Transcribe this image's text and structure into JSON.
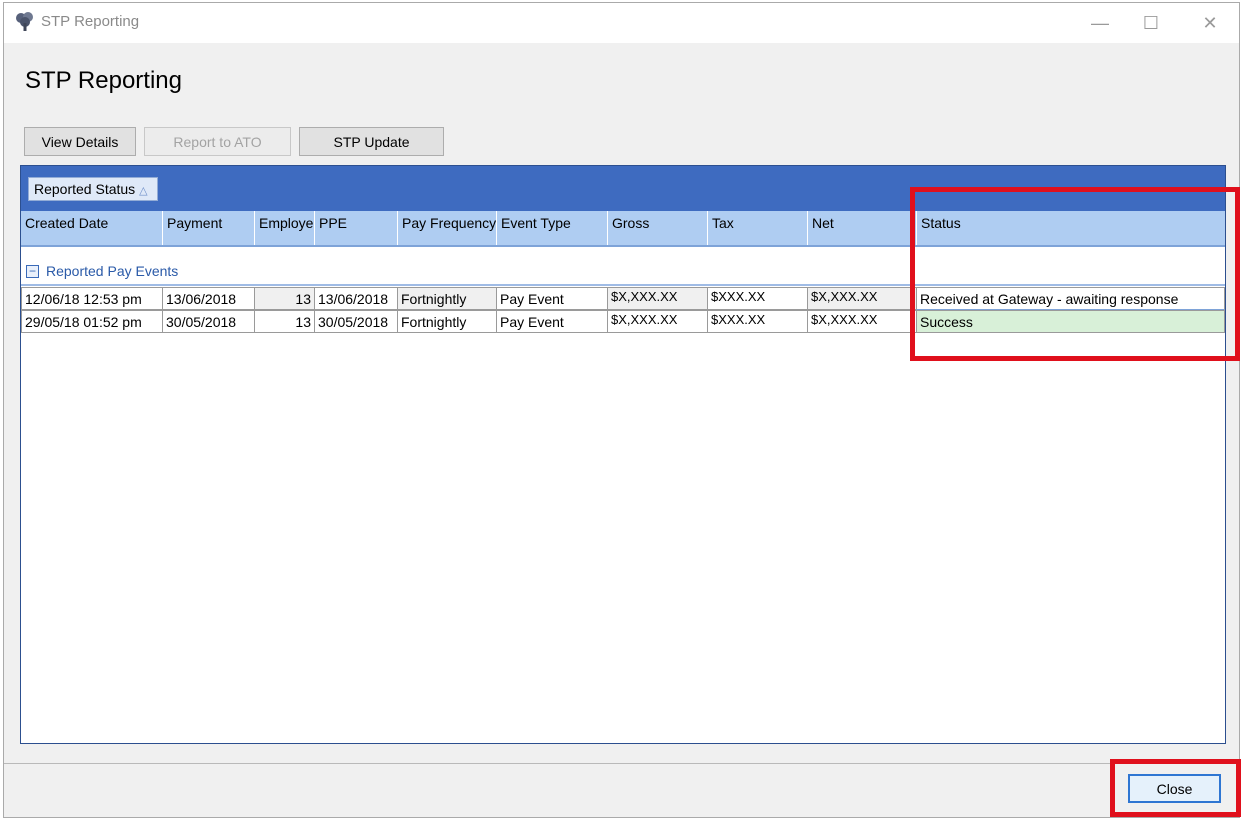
{
  "window": {
    "title": "STP Reporting",
    "controls": {
      "minimize": "—",
      "maximize": "☐",
      "close": "✕"
    }
  },
  "page_title": "STP Reporting",
  "toolbar": {
    "view_details": "View Details",
    "report_to_ato": "Report to ATO",
    "stp_update": "STP Update"
  },
  "grid": {
    "group_by_chip": "Reported Status",
    "group_by_sort_icon": "△",
    "columns": [
      "Created Date",
      "Payment",
      "Employe",
      "PPE",
      "Pay Frequency",
      "Event Type",
      "Gross",
      "Tax",
      "Net",
      "Status"
    ],
    "group": {
      "toggle": "−",
      "label": "Reported Pay Events"
    },
    "rows": [
      {
        "created_date": "12/06/18 12:53 pm",
        "payment": "13/06/2018",
        "employees": "13",
        "ppe": "13/06/2018",
        "pay_frequency": "Fortnightly",
        "event_type": "Pay Event",
        "gross": "$X,XXX.XX",
        "tax": "$XXX.XX",
        "net": "$X,XXX.XX",
        "status": "Received at Gateway - awaiting response"
      },
      {
        "created_date": "29/05/18 01:52 pm",
        "payment": "30/05/2018",
        "employees": "13",
        "ppe": "30/05/2018",
        "pay_frequency": "Fortnightly",
        "event_type": "Pay Event",
        "gross": "$X,XXX.XX",
        "tax": "$XXX.XX",
        "net": "$X,XXX.XX",
        "status": "Success"
      }
    ]
  },
  "footer": {
    "close": "Close"
  },
  "colors": {
    "group_panel": "#3e6bc0",
    "header": "#afcdf2",
    "success_row": "#d8f0d8",
    "highlight": "#e0101c"
  },
  "icons": {
    "app": "tree-icon"
  }
}
